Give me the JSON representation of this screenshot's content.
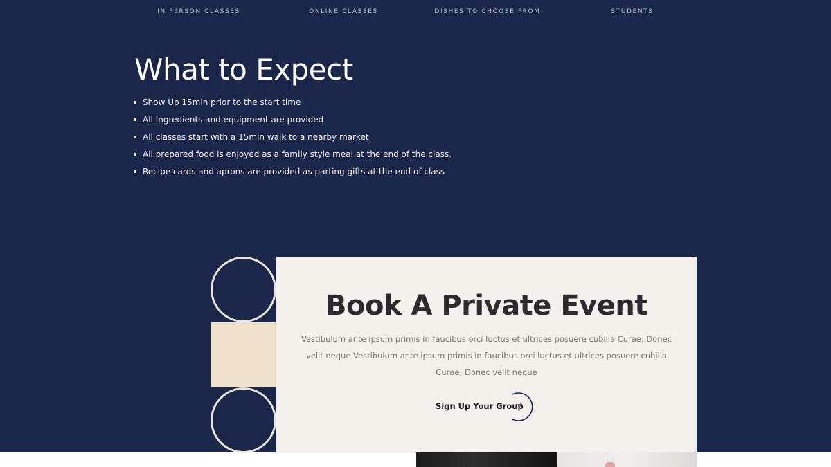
{
  "nav_stats": [
    {
      "label": "IN PERSON CLASSES"
    },
    {
      "label": "ONLINE CLASSES"
    },
    {
      "label": "DISHES TO CHOOSE FROM"
    },
    {
      "label": "STUDENTS"
    }
  ],
  "expect": {
    "title": "What to Expect",
    "items": [
      "Show Up 15min prior to the start time",
      "All Ingredients and equipment are provided",
      "All classes start with a 15min walk to a nearby market",
      "All prepared food is enjoyed as a family style meal at the end of the class.",
      "Recipe cards and aprons are provided as parting gifts at the end of class"
    ]
  },
  "event": {
    "title": "Book A Private Event",
    "description": "Vestibulum ante ipsum primis in faucibus orci luctus et ultrices posuere cubilia Curae; Donec velit neque Vestibulum ante ipsum primis in faucibus orci luctus et ultrices posuere cubilia Curae; Donec velit neque",
    "cta_label": "Sign Up Your Group",
    "cta_arrow": "→"
  },
  "colors": {
    "navy": "#1b2749",
    "cream": "#f4f0eb",
    "beige": "#f0e1cb",
    "text_dark": "#2c2a2a"
  },
  "icons": {
    "cta_arrow": "arrow-right-icon",
    "cta_ring": "circle-outline-icon"
  }
}
